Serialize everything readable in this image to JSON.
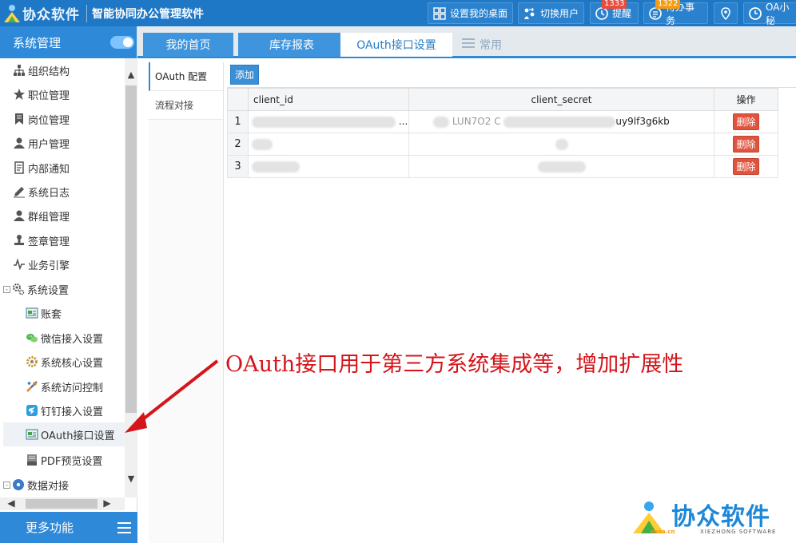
{
  "header": {
    "logo_text": "协众软件",
    "app_title": "智能协同办公管理软件",
    "buttons": {
      "set_desktop": "设置我的桌面",
      "switch_user": "切换用户",
      "remind": "提醒",
      "remind_count": "1333",
      "todo": "待办事务",
      "todo_count": "1322",
      "oa_assistant": "OA小秘"
    }
  },
  "sidebar": {
    "title": "系统管理",
    "items": [
      {
        "label": "组织结构",
        "icon": "org-tree-icon"
      },
      {
        "label": "职位管理",
        "icon": "star-icon"
      },
      {
        "label": "岗位管理",
        "icon": "bookmark-icon"
      },
      {
        "label": "用户管理",
        "icon": "user-icon"
      },
      {
        "label": "内部通知",
        "icon": "document-icon"
      },
      {
        "label": "系统日志",
        "icon": "pencil-icon"
      },
      {
        "label": "群组管理",
        "icon": "user-icon"
      },
      {
        "label": "签章管理",
        "icon": "stamp-icon"
      },
      {
        "label": "业务引擎",
        "icon": "pulse-icon"
      },
      {
        "label": "系统设置",
        "icon": "gears-icon",
        "expander": "-"
      },
      {
        "label": "账套",
        "icon": "ledger-icon"
      },
      {
        "label": "微信接入设置",
        "icon": "wechat-icon"
      },
      {
        "label": "系统核心设置",
        "icon": "gear-icon"
      },
      {
        "label": "系统访问控制",
        "icon": "tools-icon"
      },
      {
        "label": "钉钉接入设置",
        "icon": "dingtalk-icon"
      },
      {
        "label": "OAuth接口设置",
        "icon": "window-icon"
      },
      {
        "label": "PDF预览设置",
        "icon": "pdf-icon"
      },
      {
        "label": "数据对接",
        "icon": "disc-icon",
        "expander": "-"
      }
    ],
    "more": "更多功能"
  },
  "tabs": [
    {
      "label": "我的首页",
      "state": "inactive"
    },
    {
      "label": "库存报表",
      "state": "inactive"
    },
    {
      "label": "OAuth接口设置",
      "state": "active"
    },
    {
      "label": "常用",
      "state": "extra"
    }
  ],
  "subnav": [
    "OAuth 配置",
    "流程对接"
  ],
  "toolbar": {
    "add_label": "添加"
  },
  "grid": {
    "columns": [
      "client_id",
      "client_secret",
      "操作"
    ],
    "rows": [
      {
        "num": "1",
        "client_id_tail": "...",
        "secret_fragment_start": "LUN7O2 C",
        "secret_fragment_end": "uy9lf3g6kb",
        "action": "删除"
      },
      {
        "num": "2",
        "action": "删除"
      },
      {
        "num": "3",
        "action": "删除"
      }
    ]
  },
  "annotation": "OAuth接口用于第三方系统集成等，增加扩展性",
  "watermark": {
    "cn": "协众软件",
    "en": "XIEZHONG SOFTWARE",
    "domain": "cnoa.cn"
  },
  "colors": {
    "primary": "#2e8ad8",
    "topbar": "#1f78c6",
    "annotation": "#d4151b",
    "delete": "#e0533d"
  }
}
